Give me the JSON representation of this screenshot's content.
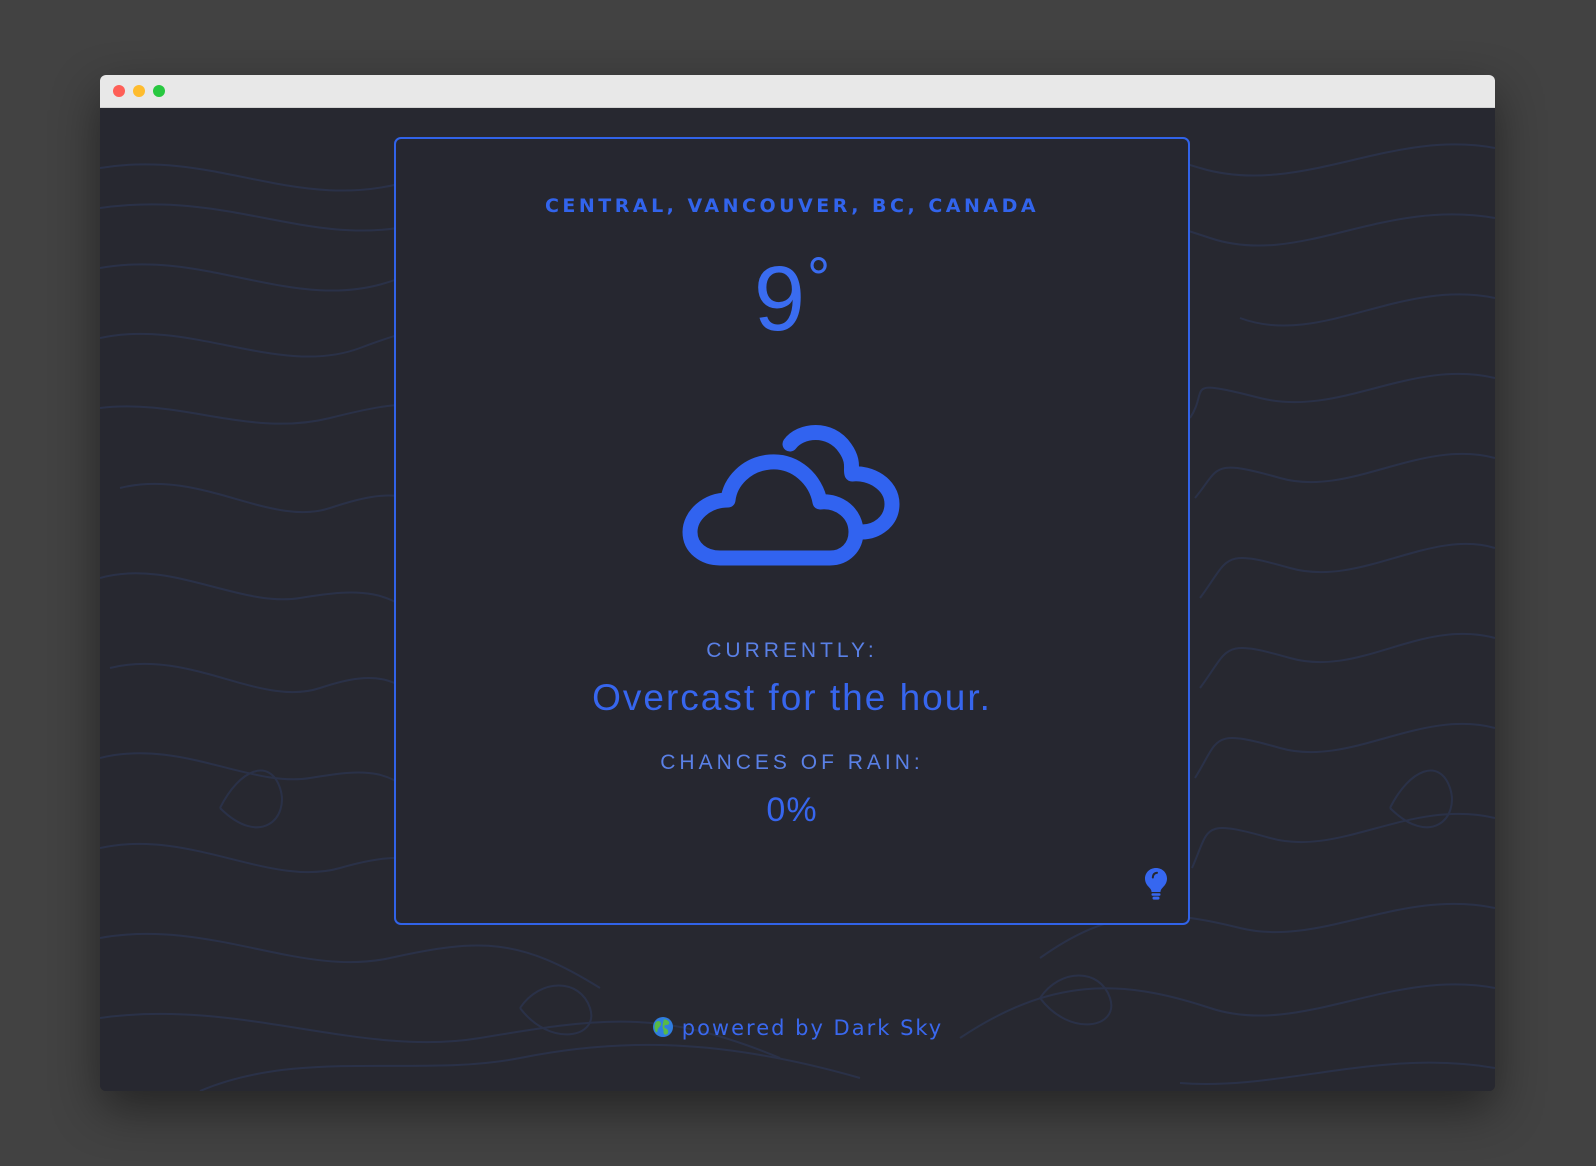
{
  "window": {
    "buttons": [
      "close",
      "minimize",
      "maximize"
    ]
  },
  "weather": {
    "location": "CENTRAL, VANCOUVER, BC, CANADA",
    "temperature": "9",
    "degree_symbol": "°",
    "icon": "cloudy-icon",
    "currently_label": "CURRENTLY:",
    "summary": "Overcast for the hour.",
    "rain_label": "CHANCES OF RAIN:",
    "rain_value": "0%",
    "theme_toggle_icon": "lightbulb-icon"
  },
  "footer": {
    "globe_icon": "globe-icon",
    "text": "powered by Dark Sky"
  },
  "colors": {
    "accent": "#3264ec",
    "background": "#272830",
    "titlebar": "#e8e8e8"
  }
}
